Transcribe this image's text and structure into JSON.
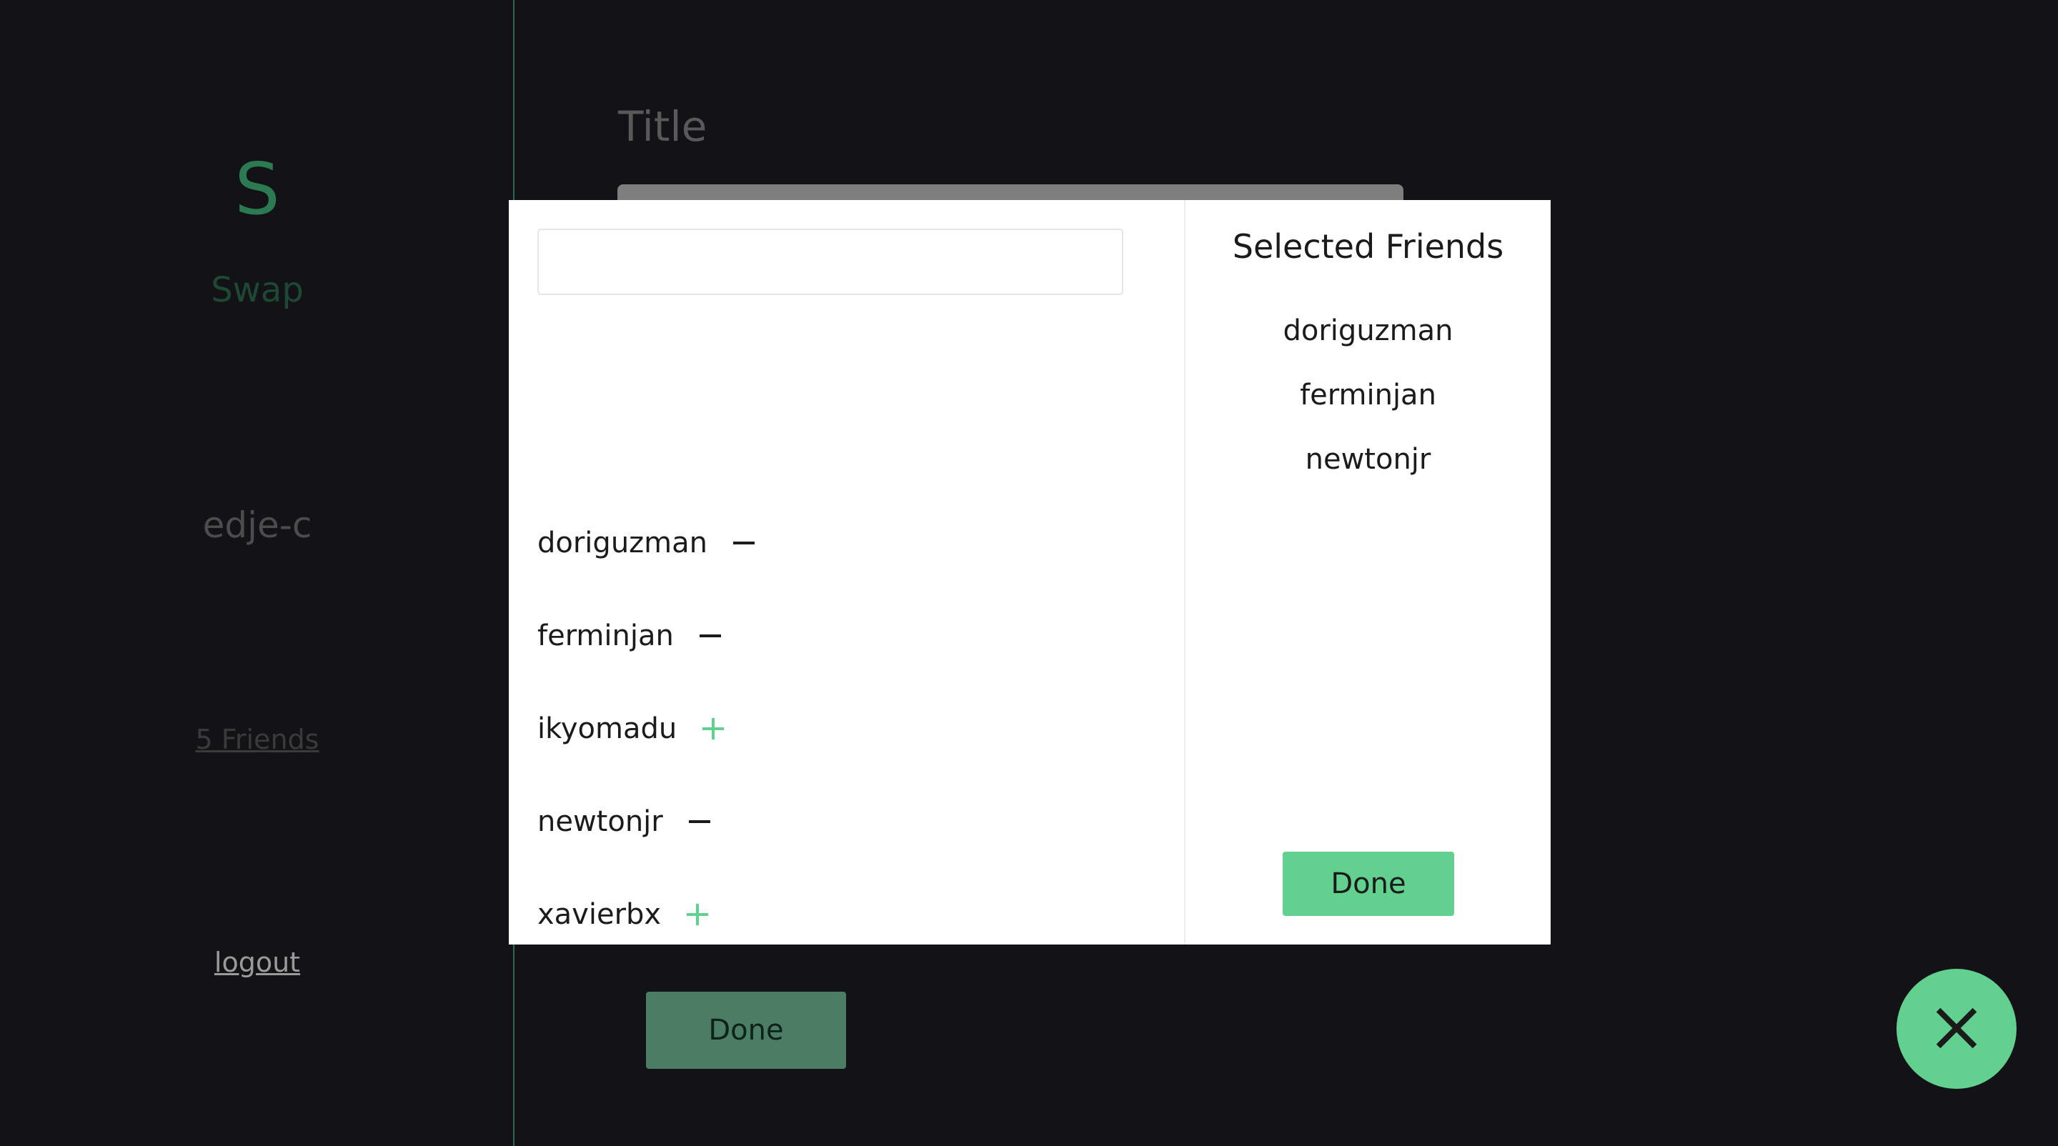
{
  "sidebar": {
    "logo_letter": "S",
    "logo_name": "Swap",
    "username": "edje-c",
    "friends_link": "5 Friends",
    "logout": "logout"
  },
  "main": {
    "title_label": "Title",
    "done_label": "Done"
  },
  "modal": {
    "search": {
      "value": "",
      "placeholder": ""
    },
    "friends": [
      {
        "name": "doriguzman",
        "selected": true,
        "action_icon": "minus-icon"
      },
      {
        "name": "ferminjan",
        "selected": true,
        "action_icon": "minus-icon"
      },
      {
        "name": "ikyomadu",
        "selected": false,
        "action_icon": "plus-icon"
      },
      {
        "name": "newtonjr",
        "selected": true,
        "action_icon": "minus-icon"
      },
      {
        "name": "xavierbx",
        "selected": false,
        "action_icon": "plus-icon"
      }
    ],
    "selected_title": "Selected Friends",
    "selected": [
      "doriguzman",
      "ferminjan",
      "newtonjr"
    ],
    "done_label": "Done"
  },
  "fab": {
    "icon": "close-icon"
  },
  "colors": {
    "background": "#131317",
    "accent": "#62d18f",
    "accent_dim": "#4a7d64",
    "sidebar_border": "#2c6a4a"
  }
}
